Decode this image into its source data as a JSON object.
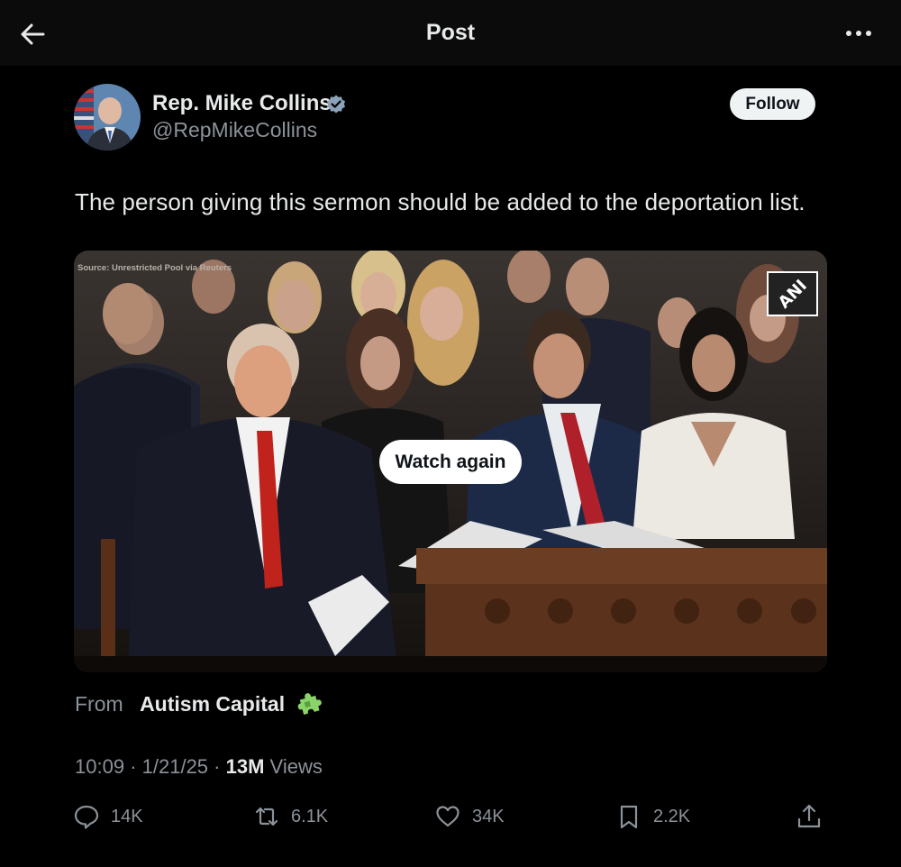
{
  "header": {
    "title": "Post",
    "back_icon": "arrow-left-icon",
    "more_icon": "more-horizontal-icon"
  },
  "author": {
    "name": "Rep. Mike Collins",
    "handle": "@RepMikeCollins",
    "verified": true,
    "verified_color": "#8ba2b8",
    "follow_label": "Follow"
  },
  "post": {
    "text": "The person giving this sermon should be added to the deportation list."
  },
  "media": {
    "source_credit": "Source: Unrestricted Pool via Reuters",
    "watermark": "ANI",
    "watch_again_label": "Watch again"
  },
  "attribution": {
    "from_label": "From",
    "source_name": "Autism Capital",
    "source_icon": "puzzle-piece-icon"
  },
  "meta": {
    "time": "10:09",
    "separator": "·",
    "date": "1/21/25",
    "views_count": "13M",
    "views_label": "Views"
  },
  "actions": {
    "replies": "14K",
    "reposts": "6.1K",
    "likes": "34K",
    "bookmarks": "2.2K"
  },
  "colors": {
    "background": "#000000",
    "topbar": "#0b0b0b",
    "primary_text": "#e7e9ea",
    "secondary_text": "#8b9299",
    "button_bg": "#eff3f4"
  }
}
